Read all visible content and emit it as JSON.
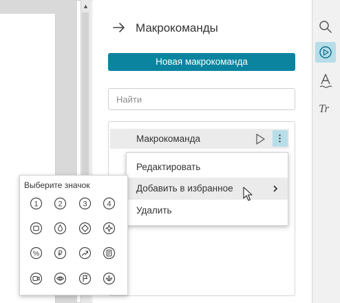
{
  "panel": {
    "title": "Макрокоманды",
    "new_button": "Новая макрокоманда",
    "search_placeholder": "Найти"
  },
  "macros": [
    {
      "label": "Макрокоманда"
    }
  ],
  "context_menu": {
    "items": [
      {
        "label": "Редактировать"
      },
      {
        "label": "Добавить в избранное",
        "has_submenu": true
      },
      {
        "label": "Удалить"
      }
    ]
  },
  "icon_picker": {
    "title": "Выберите значок",
    "icons": [
      {
        "name": "digit-1-icon",
        "glyph": "1"
      },
      {
        "name": "digit-2-icon",
        "glyph": "2"
      },
      {
        "name": "digit-3-icon",
        "glyph": "3"
      },
      {
        "name": "digit-4-icon",
        "glyph": "4"
      },
      {
        "name": "square-icon"
      },
      {
        "name": "drop-icon"
      },
      {
        "name": "diamond-icon"
      },
      {
        "name": "sparkle-icon"
      },
      {
        "name": "percent-icon",
        "glyph": "%"
      },
      {
        "name": "ruble-icon",
        "glyph": "₽"
      },
      {
        "name": "trend-up-icon"
      },
      {
        "name": "document-icon"
      },
      {
        "name": "video-icon"
      },
      {
        "name": "eye-icon"
      },
      {
        "name": "flag-icon"
      },
      {
        "name": "lotus-icon"
      }
    ]
  },
  "toolbar": [
    {
      "name": "search-icon"
    },
    {
      "name": "macro-play-icon",
      "active": true
    },
    {
      "name": "text-art-icon"
    },
    {
      "name": "text-style-icon"
    }
  ],
  "colors": {
    "accent": "#0b84a0",
    "active_highlight": "#b7dde9",
    "hover": "#ebebeb"
  }
}
